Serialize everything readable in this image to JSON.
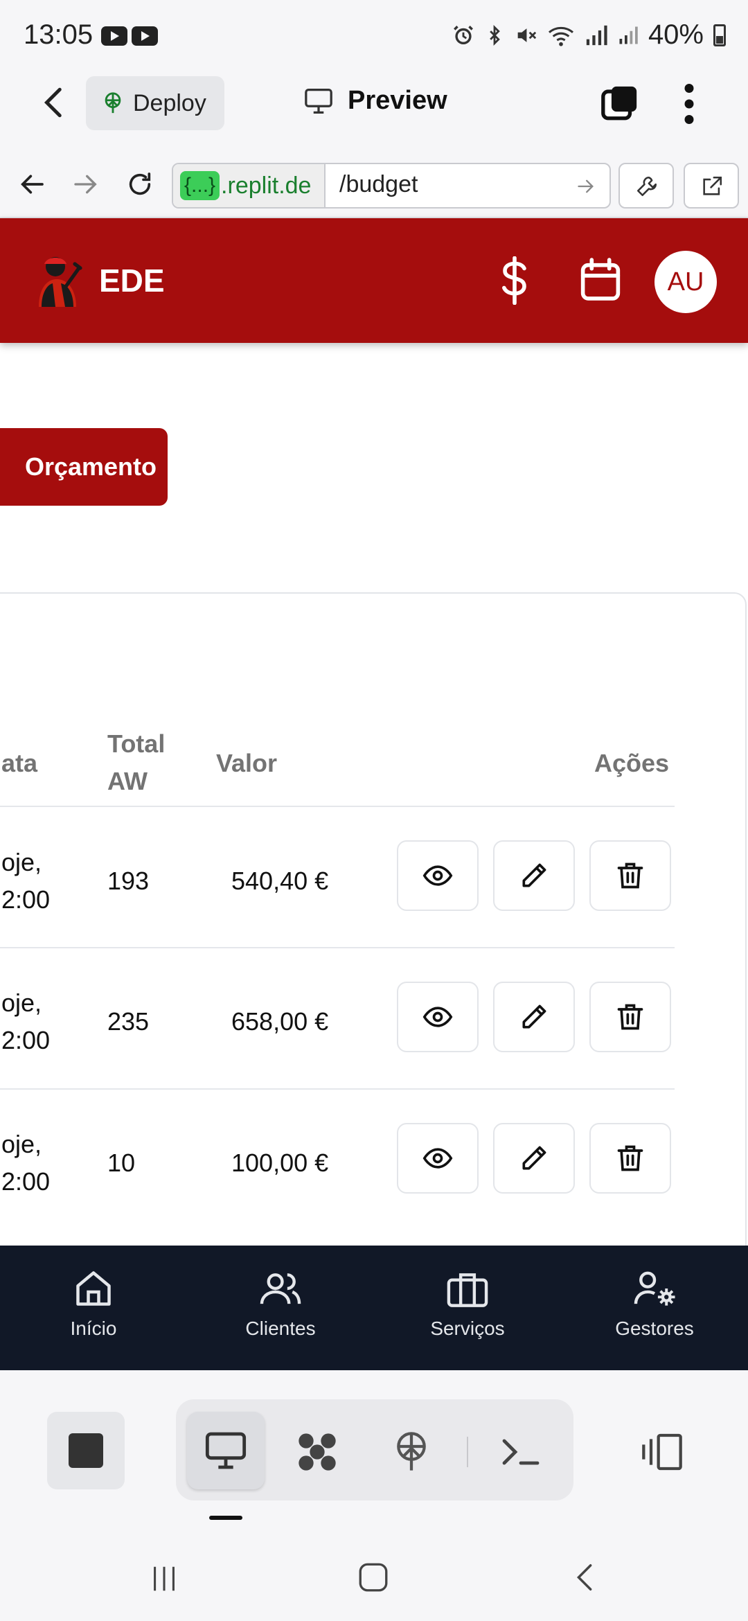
{
  "status_bar": {
    "time": "13:05",
    "battery": "40%"
  },
  "replit": {
    "deploy_label": "Deploy",
    "preview_label": "Preview",
    "url_dev_badge": "{...}",
    "url_domain": ".replit.de",
    "url_path": "/budget"
  },
  "app": {
    "title": "EDE",
    "avatar_initials": "AU",
    "new_button_label": "Orçamento"
  },
  "table": {
    "headers": {
      "date": "ata",
      "total_aw_line1": "Total",
      "total_aw_line2": "AW",
      "value": "Valor",
      "actions": "Ações"
    },
    "rows": [
      {
        "date_line1": "oje,",
        "date_line2": "2:00",
        "total_aw": "193",
        "value": "540,40 €"
      },
      {
        "date_line1": "oje,",
        "date_line2": "2:00",
        "total_aw": "235",
        "value": "658,00 €"
      },
      {
        "date_line1": "oje,",
        "date_line2": "2:00",
        "total_aw": "10",
        "value": "100,00 €"
      }
    ]
  },
  "bottom_nav": {
    "items": [
      {
        "label": "Início",
        "icon": "home-icon"
      },
      {
        "label": "Clientes",
        "icon": "users-icon"
      },
      {
        "label": "Serviços",
        "icon": "briefcase-icon"
      },
      {
        "label": "Gestores",
        "icon": "user-gear-icon"
      }
    ]
  },
  "colors": {
    "brand": "#a50d0d",
    "nav_bg": "#111827"
  }
}
